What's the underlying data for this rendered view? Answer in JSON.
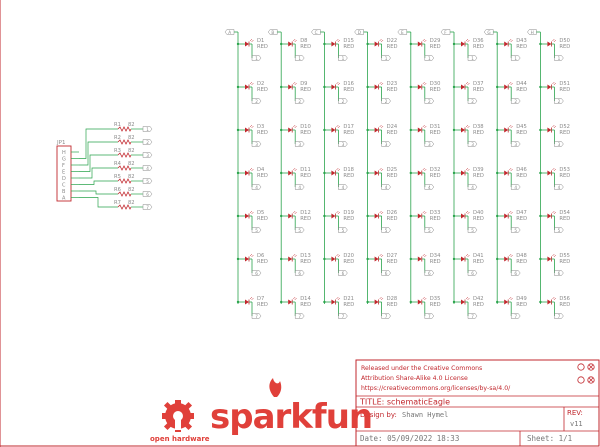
{
  "columns": [
    {
      "tag": "A",
      "leds": [
        "D1",
        "D2",
        "D3",
        "D4",
        "D5",
        "D6",
        "D7"
      ]
    },
    {
      "tag": "B",
      "leds": [
        "D8",
        "D9",
        "D10",
        "D11",
        "D12",
        "D13",
        "D14"
      ]
    },
    {
      "tag": "C",
      "leds": [
        "D15",
        "D16",
        "D17",
        "D18",
        "D19",
        "D20",
        "D21"
      ]
    },
    {
      "tag": "D",
      "leds": [
        "D22",
        "D23",
        "D24",
        "D25",
        "D26",
        "D27",
        "D28"
      ]
    },
    {
      "tag": "E",
      "leds": [
        "D29",
        "D30",
        "D31",
        "D32",
        "D33",
        "D34",
        "D35"
      ]
    },
    {
      "tag": "F",
      "leds": [
        "D36",
        "D37",
        "D38",
        "D39",
        "D40",
        "D41",
        "D42"
      ]
    },
    {
      "tag": "G",
      "leds": [
        "D43",
        "D44",
        "D45",
        "D46",
        "D47",
        "D48",
        "D49"
      ]
    },
    {
      "tag": "H",
      "leds": [
        "D50",
        "D51",
        "D52",
        "D53",
        "D54",
        "D55",
        "D56"
      ]
    }
  ],
  "led_value": "RED",
  "row_tags": [
    "1",
    "2",
    "3",
    "4",
    "5",
    "6",
    "7"
  ],
  "connector": {
    "name": "JP1",
    "pins": [
      "H",
      "G",
      "F",
      "E",
      "D",
      "C",
      "B",
      "A"
    ]
  },
  "resistors": [
    {
      "name": "R1",
      "value": "82",
      "tag": "1"
    },
    {
      "name": "R2",
      "value": "82",
      "tag": "2"
    },
    {
      "name": "R3",
      "value": "82",
      "tag": "3"
    },
    {
      "name": "R4",
      "value": "82",
      "tag": "4"
    },
    {
      "name": "R5",
      "value": "82",
      "tag": "5"
    },
    {
      "name": "R6",
      "value": "82",
      "tag": "6"
    },
    {
      "name": "R7",
      "value": "82",
      "tag": "7"
    }
  ],
  "title_block": {
    "license": [
      "Released under the Creative Commons",
      "Attribution Share-Alike 4.0 License",
      "https://creativecommons.org/licenses/by-sa/4.0/"
    ],
    "title": "TITLE: schematicEagle",
    "design_by": "Design by:",
    "designer": "Shawn Hymel",
    "rev_label": "REV:",
    "rev_value": "v11",
    "date": "Date: 05/09/2022 18:33",
    "sheet": "Sheet: 1/1",
    "brand": "sparkfun",
    "open_hardware": "open hardware"
  },
  "colors": {
    "wire": "#2aa44c",
    "part": "#c1272d",
    "label": "#8a8a8a"
  }
}
